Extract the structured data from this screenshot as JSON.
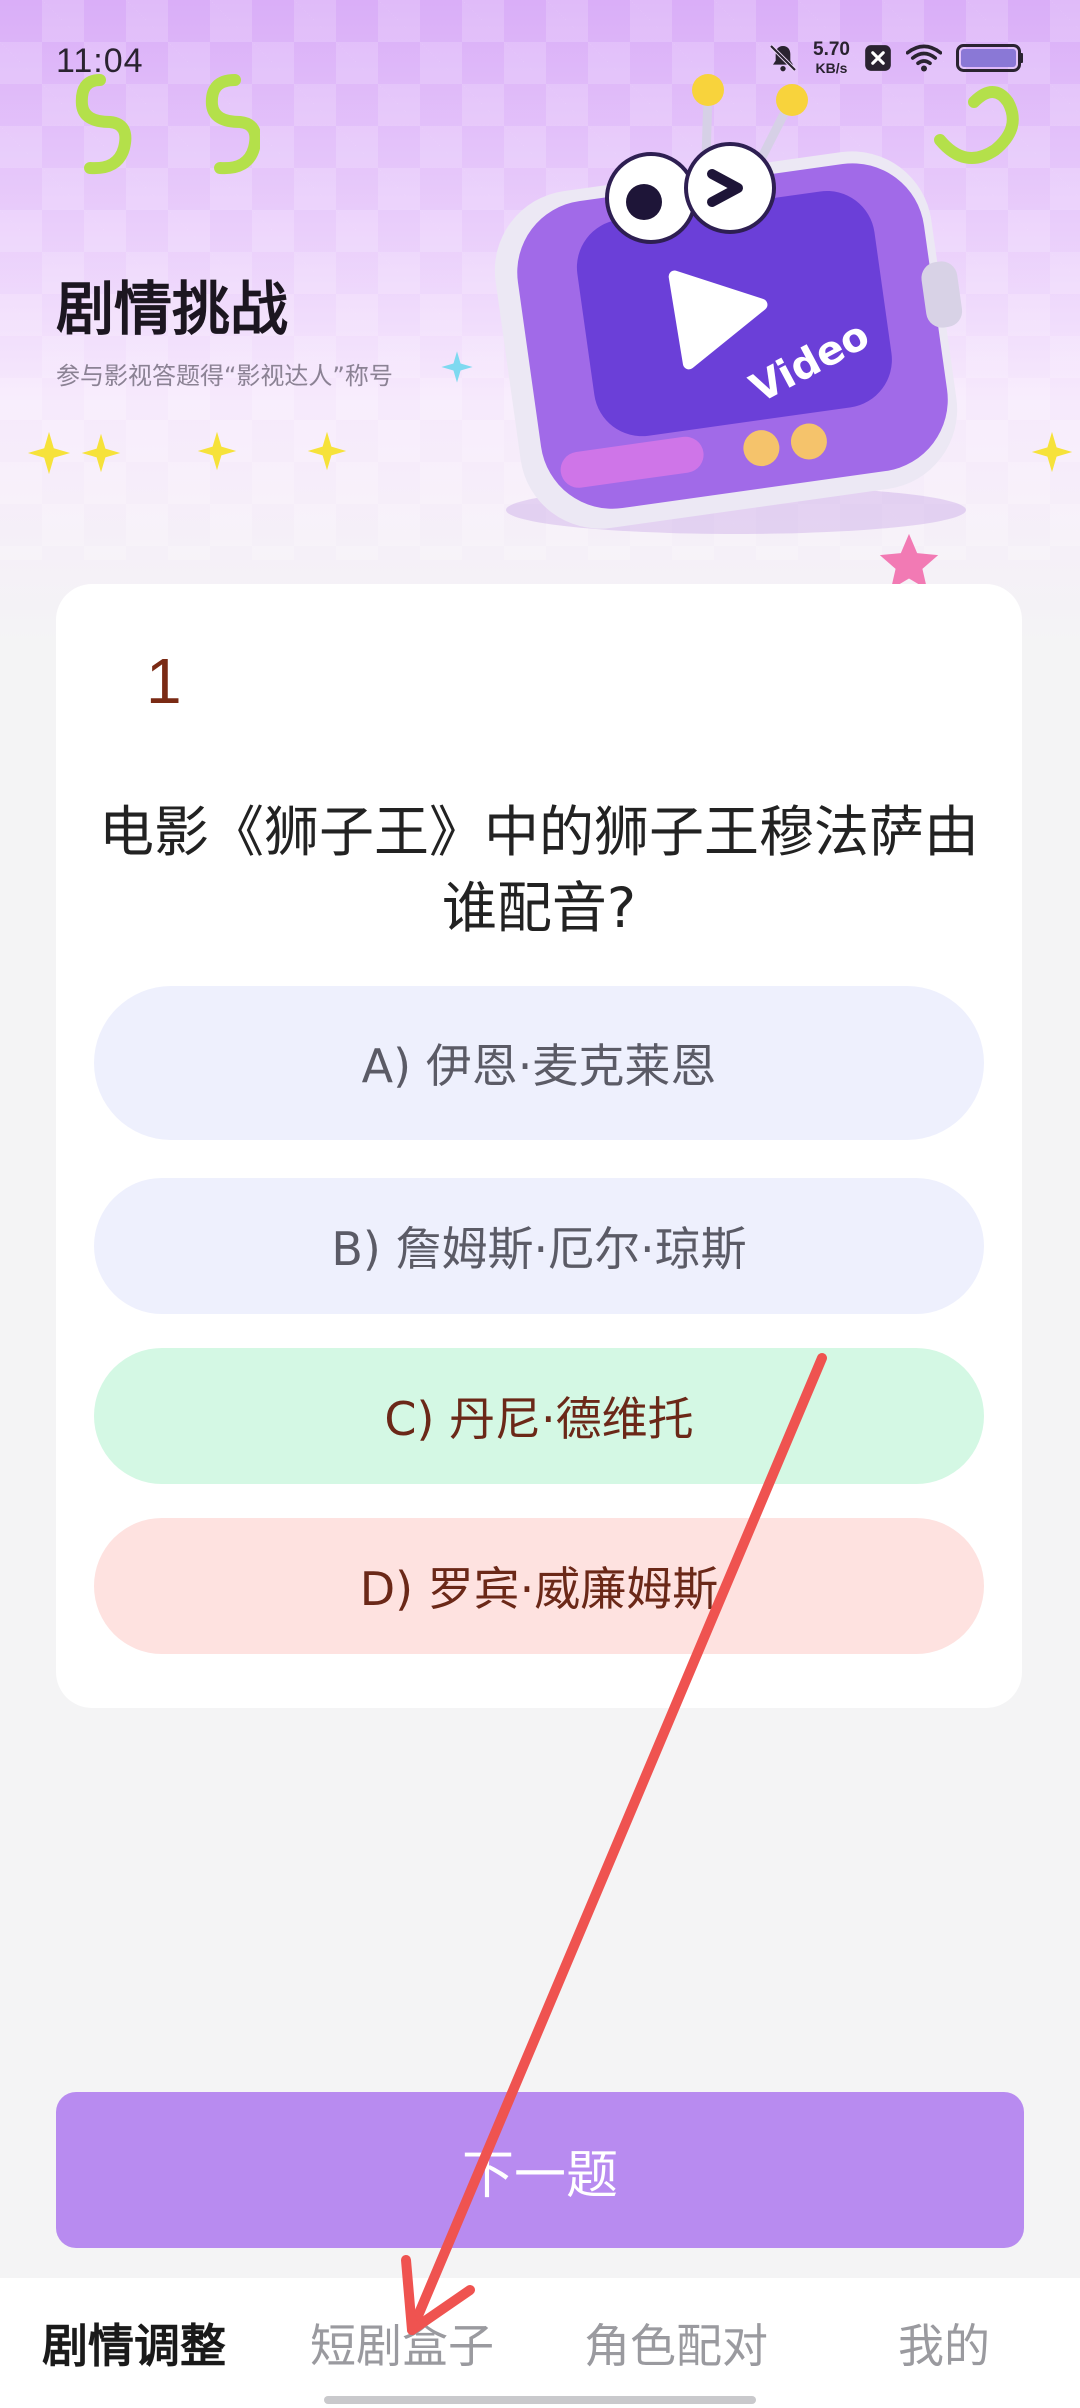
{
  "status_bar": {
    "time": "11:04",
    "net_speed_value": "5.70",
    "net_speed_unit": "KB/s",
    "icons": [
      "bell-muted-icon",
      "close-box-icon",
      "wifi-icon",
      "battery-icon"
    ]
  },
  "hero": {
    "title": "剧情挑战",
    "subtitle": "参与影视答题得“影视达人”称号",
    "illustration": "tv-mascot-illustration",
    "illustration_text": "Video"
  },
  "question": {
    "number": "1",
    "text": "电影《狮子王》中的狮子王穆法萨由谁配音?",
    "options": [
      {
        "label": "A) 伊恩·麦克莱恩",
        "state": "default"
      },
      {
        "label": "B) 詹姆斯·厄尔·琼斯",
        "state": "default"
      },
      {
        "label": "C) 丹尼·德维托",
        "state": "correct"
      },
      {
        "label": "D) 罗宾·威廉姆斯",
        "state": "wrong"
      }
    ]
  },
  "next_button": {
    "label": "下一题"
  },
  "tab_bar": {
    "tabs": [
      {
        "label": "剧情调整",
        "active": true
      },
      {
        "label": "短剧盒子",
        "active": false
      },
      {
        "label": "角色配对",
        "active": false
      },
      {
        "label": "我的",
        "active": false
      }
    ]
  },
  "colors": {
    "accent_purple": "#b88bf0",
    "correct_green": "#d4f8e4",
    "wrong_red": "#fee2e0",
    "option_default": "#eef0fd",
    "annotation_arrow": "#ef5350"
  }
}
